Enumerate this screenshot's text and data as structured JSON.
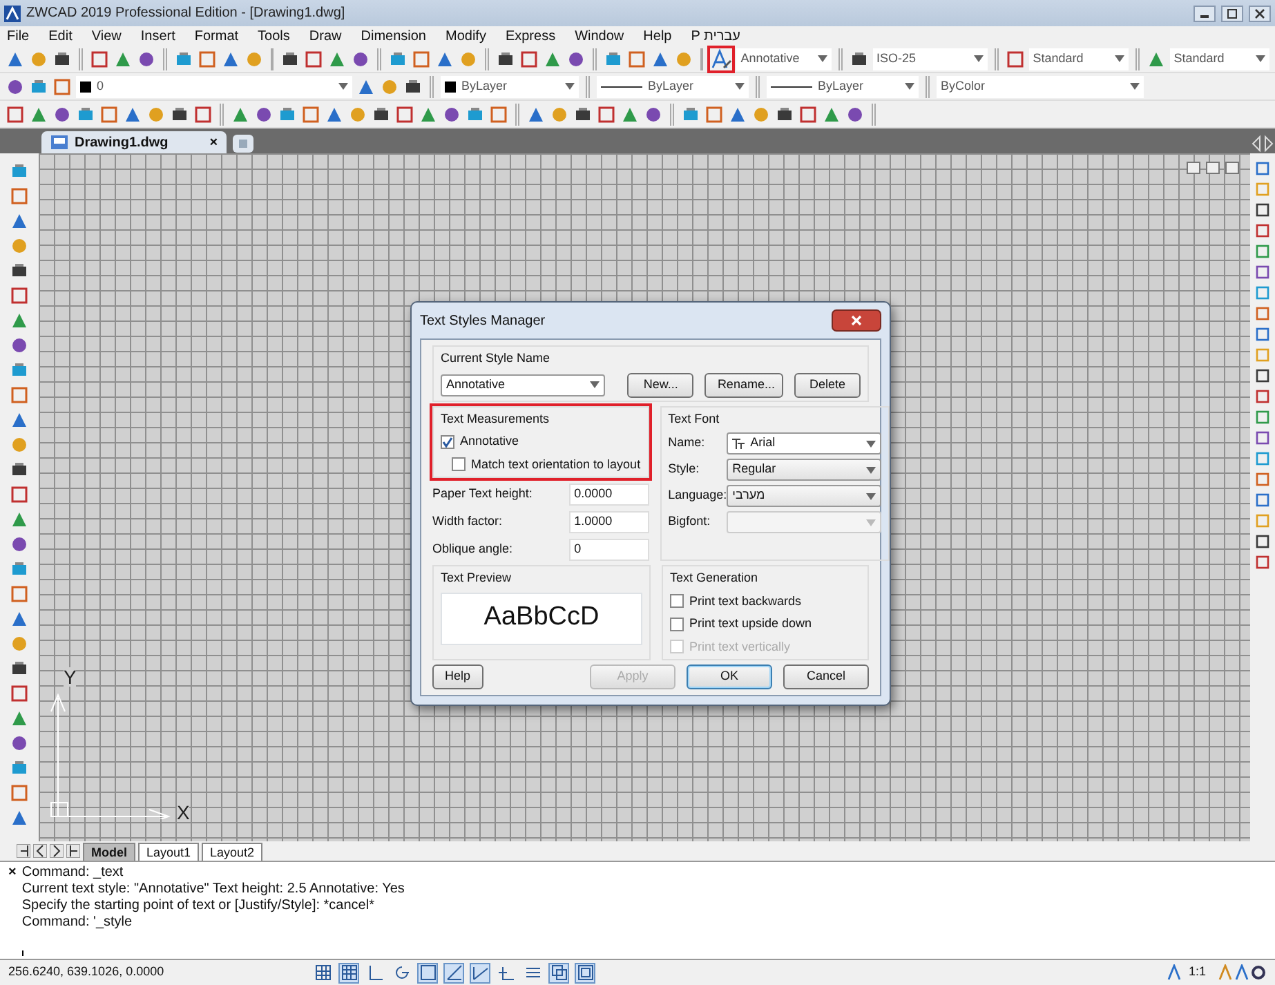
{
  "window": {
    "title": "ZWCAD 2019 Professional Edition - [Drawing1.dwg]"
  },
  "menu": [
    "File",
    "Edit",
    "View",
    "Insert",
    "Format",
    "Tools",
    "Draw",
    "Dimension",
    "Modify",
    "Express",
    "Window",
    "Help",
    "P עברית"
  ],
  "toolbar_styles": {
    "text_style_button": {
      "highlighted": true
    },
    "text_style": "Annotative",
    "dim_style": "ISO-25",
    "table_style": "Standard",
    "mleader_style": "Standard"
  },
  "toolbar_properties": {
    "layer": "0",
    "color_setting": "ByLayer",
    "linetype": "ByLayer",
    "lineweight": "ByLayer",
    "plot_style": "ByColor"
  },
  "document_tabs": [
    {
      "label": "Drawing1.dwg",
      "close": "×",
      "selected": true
    }
  ],
  "canvas": {
    "axis_y": "Y",
    "axis_x": "X"
  },
  "layout_tabs": [
    {
      "label": "Model",
      "selected": true
    },
    {
      "label": "Layout1",
      "selected": false
    },
    {
      "label": "Layout2",
      "selected": false
    }
  ],
  "command_line": {
    "close": "×",
    "lines": [
      "Command: _text",
      "Current text style: \"Annotative\"  Text height: 2.5 Annotative: Yes",
      "Specify the starting point of text or [Justify/Style]: *cancel*",
      "Command: '_style"
    ]
  },
  "status_bar": {
    "coordinates": "256.6240, 639.1026, 0.0000",
    "toggles": [
      {
        "on": false
      },
      {
        "on": true
      },
      {
        "on": false
      },
      {
        "on": false
      },
      {
        "on": true
      },
      {
        "on": true
      },
      {
        "on": true
      },
      {
        "on": false
      },
      {
        "on": false
      },
      {
        "on": true
      },
      {
        "on": true
      }
    ],
    "scale": "1:1"
  },
  "dialog": {
    "title": "Text Styles Manager",
    "current_style": {
      "label": "Current Style Name",
      "value": "Annotative"
    },
    "style_buttons": [
      "New...",
      "Rename...",
      "Delete"
    ],
    "text_measurements": {
      "title": "Text Measurements",
      "highlighted": true,
      "checkboxes": [
        {
          "label": "Annotative",
          "checked": true
        },
        {
          "label": "Match text orientation to layout",
          "checked": false
        }
      ],
      "fields": [
        {
          "label": "Paper Text height:",
          "value": "0.0000"
        },
        {
          "label": "Width factor:",
          "value": "1.0000"
        },
        {
          "label": "Oblique angle:",
          "value": "0"
        }
      ]
    },
    "text_font": {
      "title": "Text Font",
      "fields": [
        {
          "label": "Name:",
          "value": "Arial",
          "kind": "font",
          "disabled": false
        },
        {
          "label": "Style:",
          "value": "Regular",
          "kind": "plain",
          "disabled": false
        },
        {
          "label": "Language:",
          "value": "מערבי",
          "kind": "plain",
          "disabled": false
        },
        {
          "label": "Bigfont:",
          "kind": "plain",
          "disabled": true
        }
      ]
    },
    "text_preview": {
      "title": "Text Preview",
      "sample": "AaBbCcD"
    },
    "text_generation": {
      "title": "Text Generation",
      "checkboxes": [
        {
          "label": "Print text backwards",
          "checked": false,
          "disabled": false
        },
        {
          "label": "Print text upside down",
          "checked": false,
          "disabled": false
        },
        {
          "label": "Print text vertically",
          "checked": false,
          "disabled": true
        }
      ]
    },
    "footer_buttons": [
      {
        "label": "Help",
        "disabled": false,
        "default": false
      },
      {
        "label": "Apply",
        "disabled": true,
        "default": false
      },
      {
        "label": "OK",
        "disabled": false,
        "default": true
      },
      {
        "label": "Cancel",
        "disabled": false,
        "default": false
      }
    ]
  }
}
